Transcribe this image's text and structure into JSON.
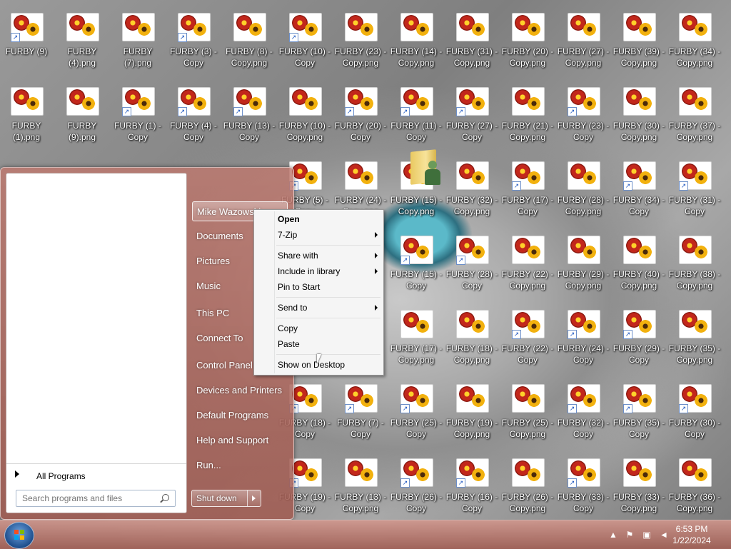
{
  "desktop": {
    "icons": [
      {
        "row": 0,
        "col": 0,
        "label": "FURBY (9)",
        "shortcut": true
      },
      {
        "row": 0,
        "col": 1,
        "label": "FURBY (4).png",
        "shortcut": false
      },
      {
        "row": 0,
        "col": 2,
        "label": "FURBY (7).png",
        "shortcut": false
      },
      {
        "row": 0,
        "col": 3,
        "label": "FURBY (3) - Copy",
        "shortcut": true
      },
      {
        "row": 0,
        "col": 4,
        "label": "FURBY (8) - Copy.png",
        "shortcut": false
      },
      {
        "row": 0,
        "col": 5,
        "label": "FURBY (10) - Copy",
        "shortcut": true
      },
      {
        "row": 0,
        "col": 6,
        "label": "FURBY (23) - Copy.png",
        "shortcut": false
      },
      {
        "row": 0,
        "col": 7,
        "label": "FURBY (14) - Copy.png",
        "shortcut": false
      },
      {
        "row": 0,
        "col": 8,
        "label": "FURBY (31) - Copy.png",
        "shortcut": false
      },
      {
        "row": 0,
        "col": 9,
        "label": "FURBY (20) - Copy.png",
        "shortcut": false
      },
      {
        "row": 0,
        "col": 10,
        "label": "FURBY (27) - Copy.png",
        "shortcut": false
      },
      {
        "row": 0,
        "col": 11,
        "label": "FURBY (39) - Copy.png",
        "shortcut": false
      },
      {
        "row": 0,
        "col": 12,
        "label": "FURBY (34) - Copy.png",
        "shortcut": false
      },
      {
        "row": 1,
        "col": 0,
        "label": "FURBY (1).png",
        "shortcut": false
      },
      {
        "row": 1,
        "col": 1,
        "label": "FURBY (9).png",
        "shortcut": false
      },
      {
        "row": 1,
        "col": 2,
        "label": "FURBY (1) - Copy",
        "shortcut": true
      },
      {
        "row": 1,
        "col": 3,
        "label": "FURBY (4) - Copy",
        "shortcut": true
      },
      {
        "row": 1,
        "col": 4,
        "label": "FURBY (13) - Copy",
        "shortcut": true
      },
      {
        "row": 1,
        "col": 5,
        "label": "FURBY (10) - Copy.png",
        "shortcut": false
      },
      {
        "row": 1,
        "col": 6,
        "label": "FURBY (20) - Copy",
        "shortcut": true
      },
      {
        "row": 1,
        "col": 7,
        "label": "FURBY (11) - Copy",
        "shortcut": true
      },
      {
        "row": 1,
        "col": 8,
        "label": "FURBY (27) - Copy",
        "shortcut": true
      },
      {
        "row": 1,
        "col": 9,
        "label": "FURBY (21) - Copy.png",
        "shortcut": false
      },
      {
        "row": 1,
        "col": 10,
        "label": "FURBY (23) - Copy",
        "shortcut": true
      },
      {
        "row": 1,
        "col": 11,
        "label": "FURBY (30) - Copy.png",
        "shortcut": false
      },
      {
        "row": 1,
        "col": 12,
        "label": "FURBY (37) - Copy.png",
        "shortcut": false
      },
      {
        "row": 2,
        "col": 5,
        "label": "FURBY (5) - Copy",
        "shortcut": true
      },
      {
        "row": 2,
        "col": 6,
        "label": "FURBY (24) - Copy.png",
        "shortcut": false
      },
      {
        "row": 2,
        "col": 7,
        "label": "FURBY (15) - Copy.png",
        "shortcut": false
      },
      {
        "row": 2,
        "col": 8,
        "label": "FURBY (32) - Copy.png",
        "shortcut": false
      },
      {
        "row": 2,
        "col": 9,
        "label": "FURBY (17) - Copy",
        "shortcut": true
      },
      {
        "row": 2,
        "col": 10,
        "label": "FURBY (28) - Copy.png",
        "shortcut": false
      },
      {
        "row": 2,
        "col": 11,
        "label": "FURBY (34) - Copy",
        "shortcut": true
      },
      {
        "row": 2,
        "col": 12,
        "label": "FURBY (31) - Copy",
        "shortcut": true
      },
      {
        "row": 3,
        "col": 7,
        "label": "FURBY (15) - Copy",
        "shortcut": true
      },
      {
        "row": 3,
        "col": 8,
        "label": "FURBY (28) - Copy",
        "shortcut": true
      },
      {
        "row": 3,
        "col": 9,
        "label": "FURBY (22) - Copy.png",
        "shortcut": false
      },
      {
        "row": 3,
        "col": 10,
        "label": "FURBY (29) - Copy.png",
        "shortcut": false
      },
      {
        "row": 3,
        "col": 11,
        "label": "FURBY (40) - Copy.png",
        "shortcut": false
      },
      {
        "row": 3,
        "col": 12,
        "label": "FURBY (38) - Copy.png",
        "shortcut": false
      },
      {
        "row": 4,
        "col": 7,
        "label": "FURBY (17) - Copy.png",
        "shortcut": false
      },
      {
        "row": 4,
        "col": 8,
        "label": "FURBY (18) - Copy.png",
        "shortcut": false
      },
      {
        "row": 4,
        "col": 9,
        "label": "FURBY (22) - Copy",
        "shortcut": true
      },
      {
        "row": 4,
        "col": 10,
        "label": "FURBY (24) - Copy",
        "shortcut": true
      },
      {
        "row": 4,
        "col": 11,
        "label": "FURBY (29) - Copy",
        "shortcut": true
      },
      {
        "row": 4,
        "col": 12,
        "label": "FURBY (35) - Copy.png",
        "shortcut": false
      },
      {
        "row": 5,
        "col": 5,
        "label": "FURBY (18) - Copy",
        "shortcut": true
      },
      {
        "row": 5,
        "col": 6,
        "label": "FURBY (7) - Copy",
        "shortcut": true
      },
      {
        "row": 5,
        "col": 7,
        "label": "FURBY (25) - Copy",
        "shortcut": true
      },
      {
        "row": 5,
        "col": 8,
        "label": "FURBY (19) - Copy.png",
        "shortcut": false
      },
      {
        "row": 5,
        "col": 9,
        "label": "FURBY (25) - Copy.png",
        "shortcut": false
      },
      {
        "row": 5,
        "col": 10,
        "label": "FURBY (32) - Copy",
        "shortcut": true
      },
      {
        "row": 5,
        "col": 11,
        "label": "FURBY (35) - Copy",
        "shortcut": true
      },
      {
        "row": 5,
        "col": 12,
        "label": "FURBY (30) - Copy",
        "shortcut": true
      },
      {
        "row": 6,
        "col": 5,
        "label": "FURBY (19) - Copy",
        "shortcut": true
      },
      {
        "row": 6,
        "col": 6,
        "label": "FURBY (13) - Copy.png",
        "shortcut": false
      },
      {
        "row": 6,
        "col": 7,
        "label": "FURBY (26) - Copy",
        "shortcut": true
      },
      {
        "row": 6,
        "col": 8,
        "label": "FURBY (16) - Copy",
        "shortcut": true
      },
      {
        "row": 6,
        "col": 9,
        "label": "FURBY (26) - Copy.png",
        "shortcut": false
      },
      {
        "row": 6,
        "col": 10,
        "label": "FURBY (33) - Copy",
        "shortcut": true
      },
      {
        "row": 6,
        "col": 11,
        "label": "FURBY (33) - Copy.png",
        "shortcut": false
      },
      {
        "row": 6,
        "col": 12,
        "label": "FURBY (36) - Copy.png",
        "shortcut": false
      }
    ]
  },
  "start_menu": {
    "all_programs": "All Programs",
    "search_placeholder": "Search programs and files",
    "user_name": "Mike Wazowski",
    "right_items": [
      "Documents",
      "Pictures",
      "Music",
      "This PC",
      "Connect To",
      "Control Panel",
      "Devices and Printers",
      "Default Programs",
      "Help and Support",
      "Run..."
    ],
    "shutdown_label": "Shut down"
  },
  "context_menu": {
    "items": [
      {
        "label": "Open",
        "bold": true,
        "submenu": false
      },
      {
        "label": "7-Zip",
        "bold": false,
        "submenu": true
      },
      {
        "label": "Share with",
        "bold": false,
        "submenu": true
      },
      {
        "label": "Include in library",
        "bold": false,
        "submenu": true
      },
      {
        "label": "Pin to Start",
        "bold": false,
        "submenu": false
      },
      {
        "label": "Send to",
        "bold": false,
        "submenu": true
      },
      {
        "label": "Copy",
        "bold": false,
        "submenu": false
      },
      {
        "label": "Paste",
        "bold": false,
        "submenu": false
      },
      {
        "label": "Show on Desktop",
        "bold": false,
        "submenu": false
      }
    ]
  },
  "taskbar": {
    "time": "6:53 PM",
    "date": "1/22/2024"
  }
}
